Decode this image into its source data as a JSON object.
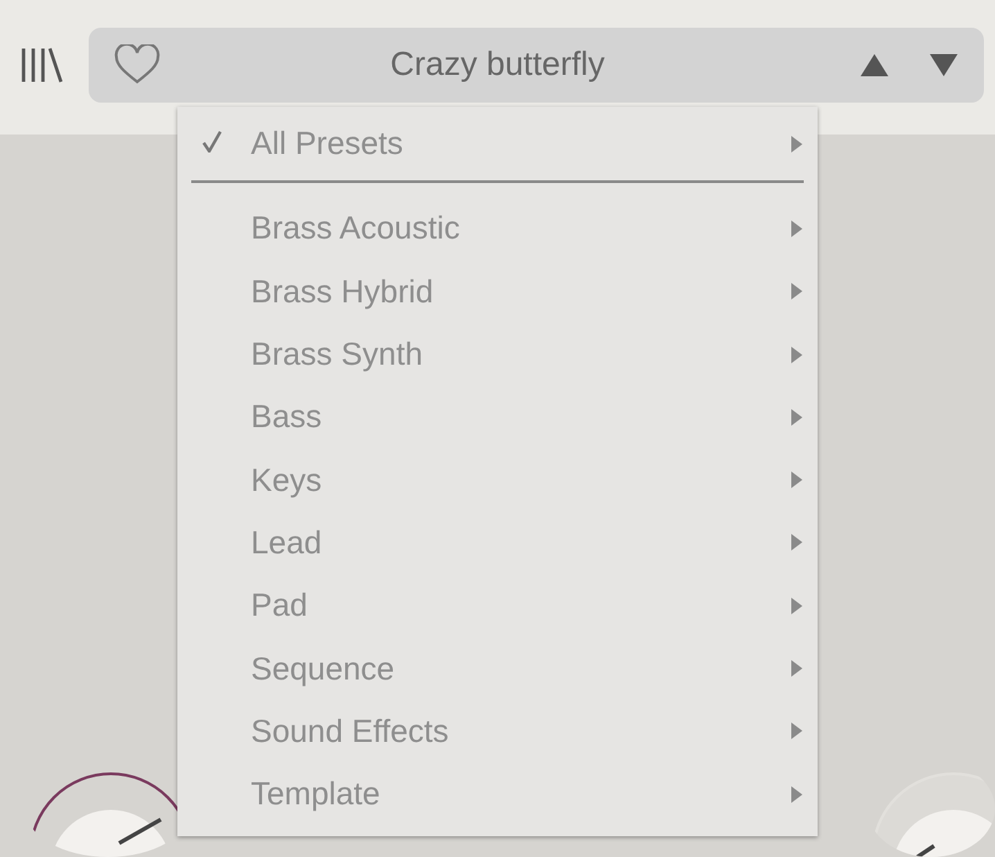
{
  "preset_bar": {
    "title": "Crazy butterfly",
    "favorite": false
  },
  "menu": {
    "items": [
      {
        "label": "All Presets",
        "checked": true,
        "kind": "header"
      },
      {
        "label": "Brass Acoustic",
        "checked": false,
        "kind": "item"
      },
      {
        "label": "Brass Hybrid",
        "checked": false,
        "kind": "item"
      },
      {
        "label": "Brass Synth",
        "checked": false,
        "kind": "item"
      },
      {
        "label": "Bass",
        "checked": false,
        "kind": "item"
      },
      {
        "label": "Keys",
        "checked": false,
        "kind": "item"
      },
      {
        "label": "Lead",
        "checked": false,
        "kind": "item"
      },
      {
        "label": "Pad",
        "checked": false,
        "kind": "item"
      },
      {
        "label": "Sequence",
        "checked": false,
        "kind": "item"
      },
      {
        "label": "Sound Effects",
        "checked": false,
        "kind": "item"
      },
      {
        "label": "Template",
        "checked": false,
        "kind": "item"
      }
    ]
  }
}
